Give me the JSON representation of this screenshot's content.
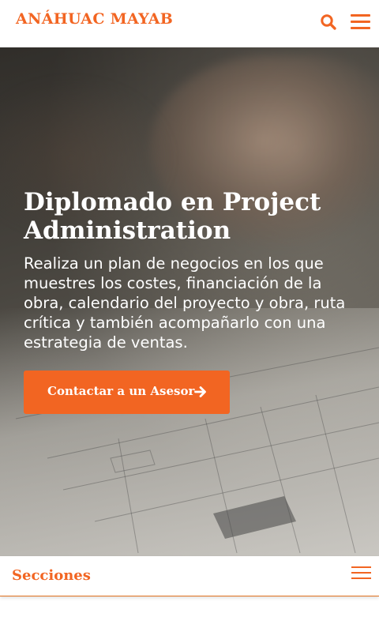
{
  "header": {
    "logo_text": "ANÁHUAC MAYAB",
    "search_icon": "search-icon",
    "menu_icon": "hamburger-menu-icon"
  },
  "hero": {
    "title": "Diplomado en Project Administration",
    "description": "Realiza un plan de negocios en los que muestres los costes, financiación de la obra, calendario del proyecto y obra, ruta crítica y también acompañarlo con una estrategia de ventas.",
    "cta_label": "Contactar a un Asesor",
    "cta_icon": "arrow-right-icon"
  },
  "sections_bar": {
    "label": "Secciones",
    "menu_icon": "hamburger-menu-icon"
  },
  "colors": {
    "accent": "#f26522",
    "text_on_hero": "#ffffff"
  }
}
